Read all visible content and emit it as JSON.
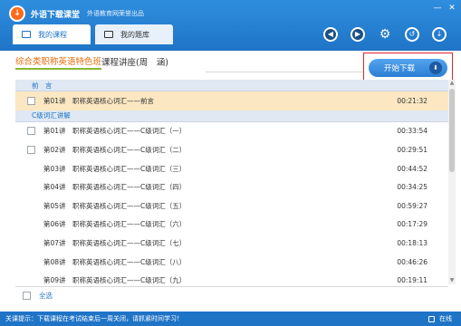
{
  "header": {
    "app_name": "外语下载课堂",
    "app_sub": "外语教育网荣誉出品",
    "tabs": [
      {
        "label": "我的课程",
        "icon": "monitor-icon",
        "active": true
      },
      {
        "label": "我的题库",
        "icon": "book-icon",
        "active": false
      }
    ],
    "window_buttons": {
      "minimize": "—",
      "close": "✕"
    }
  },
  "course": {
    "title_highlight": "综合类职称英语特色班",
    "title_rest": " 课程讲座(周　涵)",
    "download_button": "开始下载"
  },
  "sections": [
    {
      "name": "前　言",
      "rows": [
        {
          "lesson": "第01讲",
          "title": "职称英语核心词汇——前言",
          "duration": "00:21:32",
          "checkbox": true,
          "selected": true
        }
      ]
    },
    {
      "name": "C级词汇讲解",
      "rows": [
        {
          "lesson": "第01讲",
          "title": "职称英语核心词汇——C级词汇（一）",
          "duration": "00:33:54",
          "checkbox": true
        },
        {
          "lesson": "第02讲",
          "title": "职称英语核心词汇——C级词汇（二）",
          "duration": "00:29:51",
          "checkbox": true
        },
        {
          "lesson": "第03讲",
          "title": "职称英语核心词汇——C级词汇（三）",
          "duration": "00:44:52",
          "checkbox": false
        },
        {
          "lesson": "第04讲",
          "title": "职称英语核心词汇——C级词汇（四）",
          "duration": "00:34:25",
          "checkbox": false
        },
        {
          "lesson": "第05讲",
          "title": "职称英语核心词汇——C级词汇（五）",
          "duration": "00:59:27",
          "checkbox": false
        },
        {
          "lesson": "第06讲",
          "title": "职称英语核心词汇——C级词汇（六）",
          "duration": "00:17:29",
          "checkbox": false
        },
        {
          "lesson": "第07讲",
          "title": "职称英语核心词汇——C级词汇（七）",
          "duration": "00:18:13",
          "checkbox": false
        },
        {
          "lesson": "第08讲",
          "title": "职称英语核心词汇——C级词汇（八）",
          "duration": "00:46:26",
          "checkbox": false
        },
        {
          "lesson": "第09讲",
          "title": "职称英语核心词汇——C级词汇（九）",
          "duration": "00:19:11",
          "checkbox": false
        }
      ]
    }
  ],
  "footer": {
    "select_all": "全选"
  },
  "status": {
    "text": "关课提示：下载课程在考试结束后一周关闭，请抓紧时间学习！",
    "online": "在线"
  },
  "colors": {
    "header_blue": "#1f74c6",
    "title_orange": "#e36b0a",
    "selected_row": "#fbe7c2",
    "highlight_red": "#e12424"
  }
}
